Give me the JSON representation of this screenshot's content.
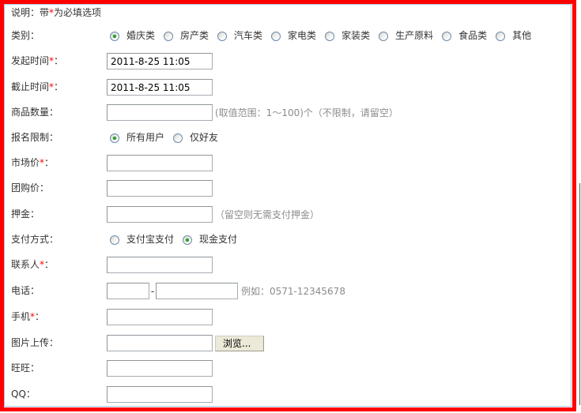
{
  "note": {
    "text_before": "说明：带",
    "star": "*",
    "text_after": "为必填选项"
  },
  "category": {
    "label": "类别：",
    "options": [
      {
        "label": "婚庆类",
        "checked": true
      },
      {
        "label": "房产类",
        "checked": false
      },
      {
        "label": "汽车类",
        "checked": false
      },
      {
        "label": "家电类",
        "checked": false
      },
      {
        "label": "家装类",
        "checked": false
      },
      {
        "label": "生产原料",
        "checked": false
      },
      {
        "label": "食品类",
        "checked": false
      },
      {
        "label": "其他",
        "checked": false
      }
    ]
  },
  "start_time": {
    "label": "发起时间",
    "star": "*",
    "colon": "：",
    "value": "2011-8-25 11:05"
  },
  "end_time": {
    "label": "截止时间",
    "star": "*",
    "colon": "：",
    "value": "2011-8-25 11:05"
  },
  "quantity": {
    "label": "商品数量：",
    "value": "",
    "hint": "(取值范围：1～100)个（不限制，请留空）"
  },
  "signup_limit": {
    "label": "报名限制：",
    "options": [
      {
        "label": "所有用户",
        "checked": true
      },
      {
        "label": "仅好友",
        "checked": false
      }
    ]
  },
  "market_price": {
    "label": "市场价",
    "star": "*",
    "colon": "：",
    "value": ""
  },
  "group_price": {
    "label": "团购价：",
    "value": ""
  },
  "deposit": {
    "label": "押金：",
    "value": "",
    "hint": "（留空则无需支付押金）"
  },
  "payment": {
    "label": "支付方式：",
    "options": [
      {
        "label": "支付宝支付",
        "checked": false
      },
      {
        "label": "现金支付",
        "checked": true
      }
    ]
  },
  "contact": {
    "label": "联系人",
    "star": "*",
    "colon": "：",
    "value": ""
  },
  "phone": {
    "label": "电话：",
    "area_code": "",
    "separator": "-",
    "number": "",
    "hint": "例如：0571-12345678"
  },
  "mobile": {
    "label": "手机",
    "star": "*",
    "colon": "：",
    "value": ""
  },
  "image_upload": {
    "label": "图片上传：",
    "path": "",
    "browse_label": "浏览..."
  },
  "wangwang": {
    "label": "旺旺：",
    "value": ""
  },
  "qq": {
    "label": "QQ：",
    "value": ""
  },
  "colors": {
    "frame_red": "#ff0000",
    "required_star": "#ff0000",
    "radio_checked": "#2b9f2b",
    "hint_text": "#8c8c8c",
    "panel_border": "#a9c6e0"
  }
}
